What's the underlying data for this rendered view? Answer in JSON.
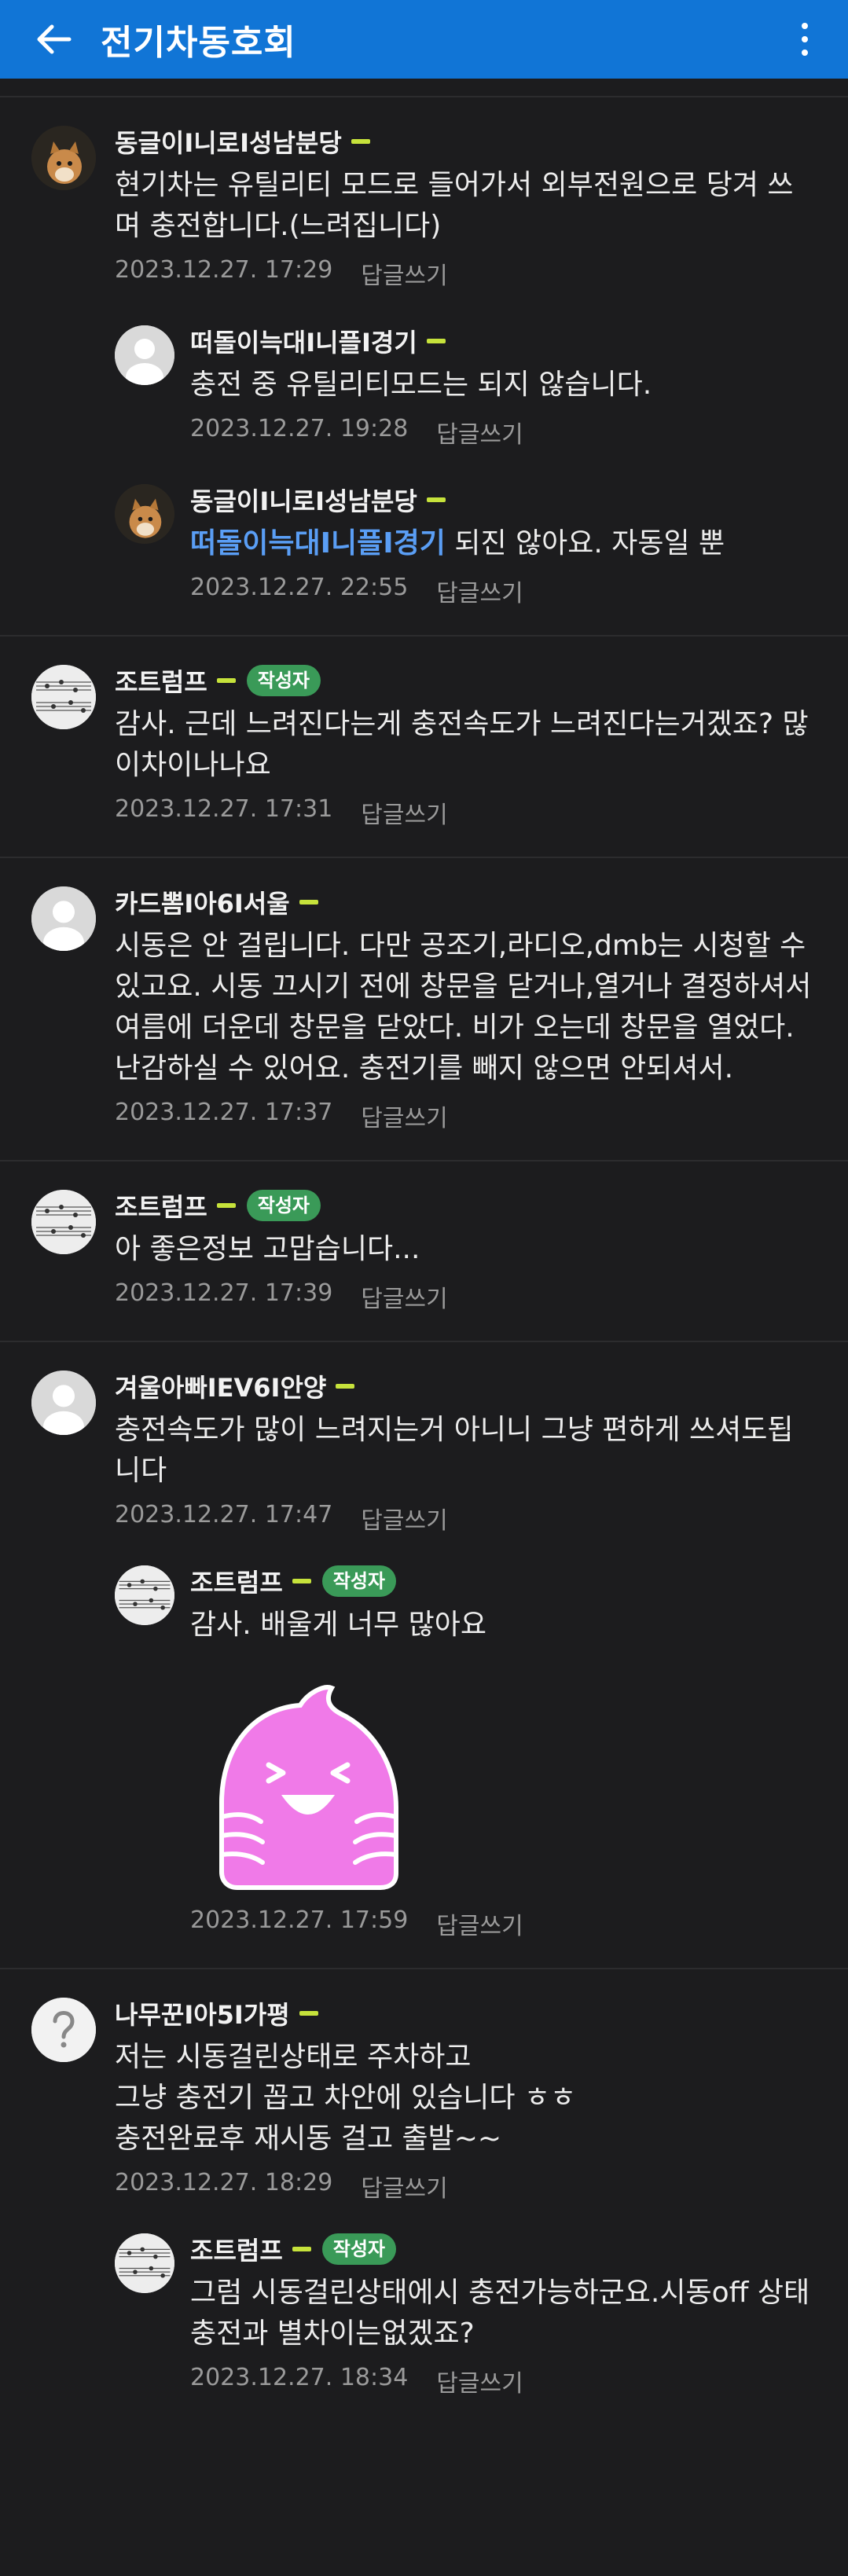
{
  "appbar": {
    "title": "전기차동호회"
  },
  "comments": [
    {
      "nickname": "동글이I니로I성남분당",
      "text": "현기차는 유틸리티 모드로 들어가서 외부전원으로 당겨 쓰며 충전합니다.(느려집니다)",
      "time": "2023.12.27. 17:29",
      "reply_label": "답글쓰기",
      "replies": [
        {
          "nickname": "떠돌이늑대I니플I경기",
          "text": "충전 중 유틸리티모드는 되지 않습니다.",
          "time": "2023.12.27. 19:28",
          "reply_label": "답글쓰기"
        },
        {
          "nickname": "동글이I니로I성남분당",
          "mention": "떠돌이늑대I니플I경기",
          "text": " 되진 않아요. 자동일 뿐",
          "time": "2023.12.27. 22:55",
          "reply_label": "답글쓰기"
        }
      ]
    },
    {
      "nickname": "조트럼프",
      "badge": "작성자",
      "text": "감사. 근데 느려진다는게 충전속도가 느려진다는거겠죠? 많이차이나나요",
      "time": "2023.12.27. 17:31",
      "reply_label": "답글쓰기"
    },
    {
      "nickname": "카드뽐I아6I서울",
      "text": "시동은 안 걸립니다. 다만 공조기,라디오,dmb는 시청할 수 있고요. 시동 끄시기 전에 창문을 닫거나,열거나 결정하셔서 여름에 더운데 창문을 닫았다. 비가 오는데 창문을 열었다. 난감하실 수 있어요. 충전기를 빼지 않으면 안되셔서.",
      "time": "2023.12.27. 17:37",
      "reply_label": "답글쓰기"
    },
    {
      "nickname": "조트럼프",
      "badge": "작성자",
      "text": "아 좋은정보 고맙습니다...",
      "time": "2023.12.27. 17:39",
      "reply_label": "답글쓰기"
    },
    {
      "nickname": "겨울아빠IEV6I안양",
      "text": "충전속도가 많이 느려지는거 아니니 그냥 편하게 쓰셔도됩니다",
      "time": "2023.12.27. 17:47",
      "reply_label": "답글쓰기",
      "replies": [
        {
          "nickname": "조트럼프",
          "badge": "작성자",
          "text": "감사. 배울게 너무 많아요",
          "time": "2023.12.27. 17:59",
          "reply_label": "답글쓰기"
        }
      ]
    },
    {
      "nickname": "나무꾼I아5I가평",
      "text": "저는 시동걸린상태로 주차하고\n그냥 충전기 꼽고 차안에 있습니다 ㅎㅎ\n충전완료후 재시동 걸고 출발~~",
      "time": "2023.12.27. 18:29",
      "reply_label": "답글쓰기",
      "replies": [
        {
          "nickname": "조트럼프",
          "badge": "작성자",
          "text": "그럼 시동걸린상태에시 충전가능하군요.시동off 상태충전과 별차이는없겠죠?",
          "time": "2023.12.27. 18:34",
          "reply_label": "답글쓰기"
        }
      ]
    }
  ],
  "colors": {
    "appbar": "#1175d6",
    "background": "#1c1c1e",
    "badge": "#3a9a58",
    "level": "#c6e23b",
    "mention": "#5a9ef5",
    "sticker": "#f07ae8"
  },
  "icons": {
    "back": "arrow-left-icon",
    "more": "more-vertical-icon",
    "sticker": "pink-blob-laughing-sticker"
  }
}
